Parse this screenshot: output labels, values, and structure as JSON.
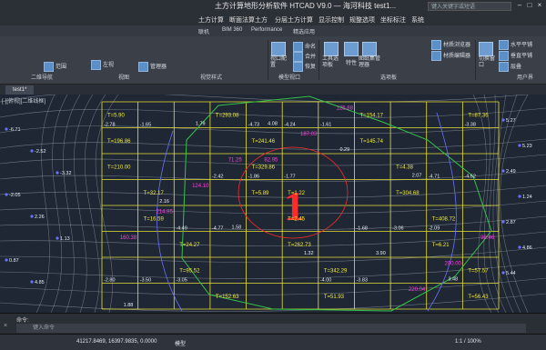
{
  "window": {
    "title": "土方计算地形分析软件 HTCAD V9.0 — 海河科技 test1...",
    "search_placeholder": "键入关键字或短语"
  },
  "menubar": [
    "土方计算",
    "断面法算土方",
    "分层土方计算",
    "显示控制",
    "规整选项",
    "坐标标注",
    "系统"
  ],
  "ribbon_tabs": [
    "联机",
    "BIM 360",
    "Performance",
    "精选应用"
  ],
  "ribbon": {
    "groups": [
      "二维导航",
      "视图",
      "视觉样式",
      "模型视口",
      "选项板",
      "用户界"
    ],
    "buttons": {
      "range": "范围",
      "view_unsaved": "左视",
      "manager": "管理器",
      "name": "命名",
      "join": "合并",
      "restore": "恢复",
      "viewport_config": "视口配置",
      "tool_palette": "工具选项板",
      "properties": "特性",
      "sheet_set": "图纸集管理器",
      "material_browser": "材质浏览器",
      "material_editor": "材质编辑器",
      "horizontal_tile": "水平平铺",
      "vertical_tile": "垂直平铺",
      "switch_window": "切换窗口",
      "file_tabs": "文件选项卡",
      "cascade": "层叠"
    }
  },
  "document_tab": "test1*",
  "viewport_label": "[-][俯视][二维线框]",
  "grid": {
    "t_labels": [
      "T=5.90",
      "T=1.22",
      "T=57.57",
      "T=241.46",
      "T=408.72",
      "T=152.63",
      "T=4.38",
      "T=24.27",
      "T=154.17",
      "T=32.17",
      "T=342.29",
      "T=196.86",
      "T=2.45",
      "T=56.43",
      "T=329.86",
      "T=6.21",
      "T=293.08",
      "T=304.68",
      "T=95.52",
      "T=145.74",
      "T=16.59",
      "T=51.93",
      "T=210.00",
      "T=262.73",
      "T=87.36",
      "T=5.89"
    ],
    "cut_values": [
      "-1.65",
      "-1.77",
      "-2.09",
      "-3.05",
      "-1.61",
      "-4.52",
      "-4.77",
      "-3.83",
      "-2.78",
      "-1.86",
      "-3.06",
      "-3.50",
      "-4.24",
      "-4.71",
      "-4.49",
      "-4.00",
      "-3.38",
      "-2.42",
      "-1.68",
      "-2.80",
      "-4.73"
    ],
    "white_values": [
      "1.79",
      "1.32",
      "2.07",
      "1.88",
      "1.58",
      "0.29",
      "3.48",
      "2.16",
      "4.08",
      "3.90"
    ],
    "magenta_values": [
      "71.25",
      "98.46",
      "125.88",
      "124.10",
      "200.00",
      "187.03",
      "214.95",
      "220.04",
      "82.95",
      "160.38"
    ],
    "edge_values": [
      "-6.71",
      "-2.52",
      "-3.32",
      "-2.05",
      "2.26",
      "1.13",
      "0.87",
      "4.85",
      "5.27",
      "5.23",
      "2.49",
      "1.24",
      "2.87",
      "4.86",
      "5.44"
    ],
    "center_marker": "1"
  },
  "command": {
    "history": "命令:",
    "placeholder": "键入命令"
  },
  "status": {
    "coords": "41217.8469, 16397.9835, 0.0000",
    "mode": "模型",
    "scale": "1:1 / 100%"
  },
  "colors": {
    "grid": "#e8e23a",
    "boundary": "#35c24a",
    "contour": "#aeb7c4",
    "zero_line": "#6a72ff",
    "label_magenta": "#ff3fe5",
    "marker_red": "#ff2a2a"
  }
}
